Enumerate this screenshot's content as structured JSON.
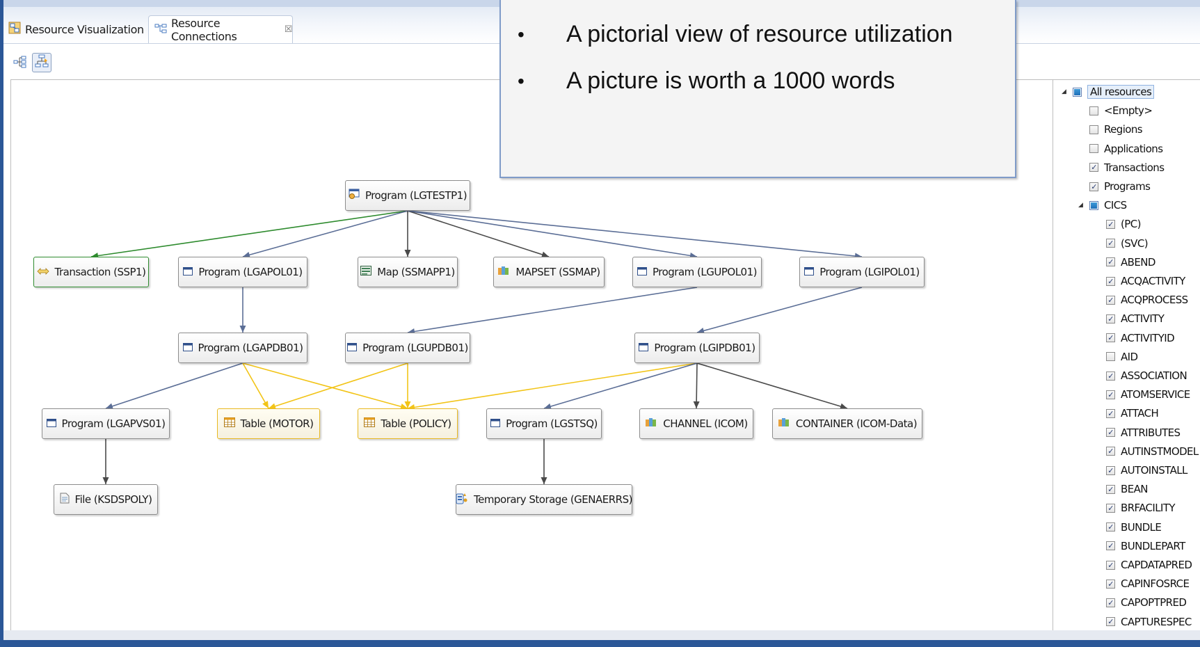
{
  "tabs": [
    {
      "label": "Resource Visualization",
      "icon": "resource-visualization-icon"
    },
    {
      "label": "Resource Connections",
      "icon": "resource-connections-icon",
      "close": "☒"
    }
  ],
  "overlay": {
    "bullets": [
      "A pictorial view of resource utilization",
      "A picture is worth a 1000 words"
    ]
  },
  "graph": {
    "nodes": [
      {
        "id": "lgtestp1",
        "label": "Program (LGTESTP1)",
        "icon": "program-gear-icon",
        "style": "default"
      },
      {
        "id": "ssp1",
        "label": "Transaction (SSP1)",
        "icon": "transaction-arrows-icon",
        "style": "green"
      },
      {
        "id": "lgapol01",
        "label": "Program (LGAPOL01)",
        "icon": "program-window-icon",
        "style": "default"
      },
      {
        "id": "ssmapp1",
        "label": "Map (SSMAPP1)",
        "icon": "map-icon",
        "style": "default"
      },
      {
        "id": "ssmap",
        "label": "MAPSET (SSMAP)",
        "icon": "mapset-books-icon",
        "style": "default"
      },
      {
        "id": "lgupol01",
        "label": "Program (LGUPOL01)",
        "icon": "program-window-icon",
        "style": "default"
      },
      {
        "id": "lgipol01",
        "label": "Program (LGIPOL01)",
        "icon": "program-window-icon",
        "style": "default"
      },
      {
        "id": "lgapdb01",
        "label": "Program (LGAPDB01)",
        "icon": "program-window-icon",
        "style": "default"
      },
      {
        "id": "lgupdb01",
        "label": "Program (LGUPDB01)",
        "icon": "program-window-icon",
        "style": "default"
      },
      {
        "id": "lgipdb01",
        "label": "Program (LGIPDB01)",
        "icon": "program-window-icon",
        "style": "default"
      },
      {
        "id": "lgapvs01",
        "label": "Program (LGAPVS01)",
        "icon": "program-window-icon",
        "style": "default"
      },
      {
        "id": "motor",
        "label": "Table (MOTOR)",
        "icon": "table-icon",
        "style": "yellow"
      },
      {
        "id": "policy",
        "label": "Table (POLICY)",
        "icon": "table-icon",
        "style": "yellow"
      },
      {
        "id": "lgstsq",
        "label": "Program (LGSTSQ)",
        "icon": "program-window-icon",
        "style": "default"
      },
      {
        "id": "icom",
        "label": "CHANNEL (ICOM)",
        "icon": "channel-books-icon",
        "style": "default"
      },
      {
        "id": "icomdata",
        "label": "CONTAINER (ICOM-Data)",
        "icon": "container-books-icon",
        "style": "default"
      },
      {
        "id": "ksdspoly",
        "label": "File (KSDSPOLY)",
        "icon": "file-icon",
        "style": "default"
      },
      {
        "id": "genaerrs",
        "label": "Temporary Storage (GENAERRS)",
        "icon": "temporary-storage-icon",
        "style": "default"
      }
    ],
    "edges": [
      {
        "from": "lgtestp1",
        "to": "ssp1",
        "color": "#2e8b2e"
      },
      {
        "from": "lgtestp1",
        "to": "lgapol01",
        "color": "#5b6e96"
      },
      {
        "from": "lgtestp1",
        "to": "ssmapp1",
        "color": "#4a4a4a"
      },
      {
        "from": "lgtestp1",
        "to": "ssmap",
        "color": "#4a4a4a"
      },
      {
        "from": "lgtestp1",
        "to": "lgupol01",
        "color": "#5b6e96"
      },
      {
        "from": "lgtestp1",
        "to": "lgipol01",
        "color": "#5b6e96"
      },
      {
        "from": "lgapol01",
        "to": "lgapdb01",
        "color": "#5b6e96"
      },
      {
        "from": "lgupol01",
        "to": "lgupdb01",
        "color": "#5b6e96"
      },
      {
        "from": "lgipol01",
        "to": "lgipdb01",
        "color": "#5b6e96"
      },
      {
        "from": "lgapdb01",
        "to": "lgapvs01",
        "color": "#5b6e96"
      },
      {
        "from": "lgapdb01",
        "to": "motor",
        "color": "#f2c417"
      },
      {
        "from": "lgapdb01",
        "to": "policy",
        "color": "#f2c417"
      },
      {
        "from": "lgupdb01",
        "to": "motor",
        "color": "#f2c417"
      },
      {
        "from": "lgupdb01",
        "to": "policy",
        "color": "#f2c417"
      },
      {
        "from": "lgipdb01",
        "to": "policy",
        "color": "#f2c417"
      },
      {
        "from": "lgipdb01",
        "to": "lgstsq",
        "color": "#5b6e96"
      },
      {
        "from": "lgipdb01",
        "to": "icom",
        "color": "#4a4a4a"
      },
      {
        "from": "lgipdb01",
        "to": "icomdata",
        "color": "#4a4a4a"
      },
      {
        "from": "lgapvs01",
        "to": "ksdspoly",
        "color": "#4a4a4a"
      },
      {
        "from": "lgstsq",
        "to": "genaerrs",
        "color": "#4a4a4a"
      }
    ]
  },
  "filter_tree": {
    "root": {
      "label": "All resources",
      "state": "partial",
      "expanded": true
    },
    "level1": [
      {
        "label": "<Empty>",
        "checked": false
      },
      {
        "label": "Regions",
        "checked": false
      },
      {
        "label": "Applications",
        "checked": false
      },
      {
        "label": "Transactions",
        "checked": true
      },
      {
        "label": "Programs",
        "checked": true
      },
      {
        "label": "CICS",
        "state": "partial",
        "expanded": true
      }
    ],
    "cics_children": [
      {
        "label": "(PC)",
        "checked": true
      },
      {
        "label": "(SVC)",
        "checked": true
      },
      {
        "label": "ABEND",
        "checked": true
      },
      {
        "label": "ACQACTIVITY",
        "checked": true
      },
      {
        "label": "ACQPROCESS",
        "checked": true
      },
      {
        "label": "ACTIVITY",
        "checked": true
      },
      {
        "label": "ACTIVITYID",
        "checked": true
      },
      {
        "label": "AID",
        "checked": false
      },
      {
        "label": "ASSOCIATION",
        "checked": true
      },
      {
        "label": "ATOMSERVICE",
        "checked": true
      },
      {
        "label": "ATTACH",
        "checked": true
      },
      {
        "label": "ATTRIBUTES",
        "checked": true
      },
      {
        "label": "AUTINSTMODEL",
        "checked": true
      },
      {
        "label": "AUTOINSTALL",
        "checked": true
      },
      {
        "label": "BEAN",
        "checked": true
      },
      {
        "label": "BRFACILITY",
        "checked": true
      },
      {
        "label": "BUNDLE",
        "checked": true
      },
      {
        "label": "BUNDLEPART",
        "checked": true
      },
      {
        "label": "CAPDATAPRED",
        "checked": true
      },
      {
        "label": "CAPINFOSRCE",
        "checked": true
      },
      {
        "label": "CAPOPTPRED",
        "checked": true
      },
      {
        "label": "CAPTURESPEC",
        "checked": true
      }
    ]
  },
  "toolbar": {
    "buttons": [
      {
        "name": "tree-layout-icon"
      },
      {
        "name": "horizontal-layout-icon"
      }
    ]
  }
}
